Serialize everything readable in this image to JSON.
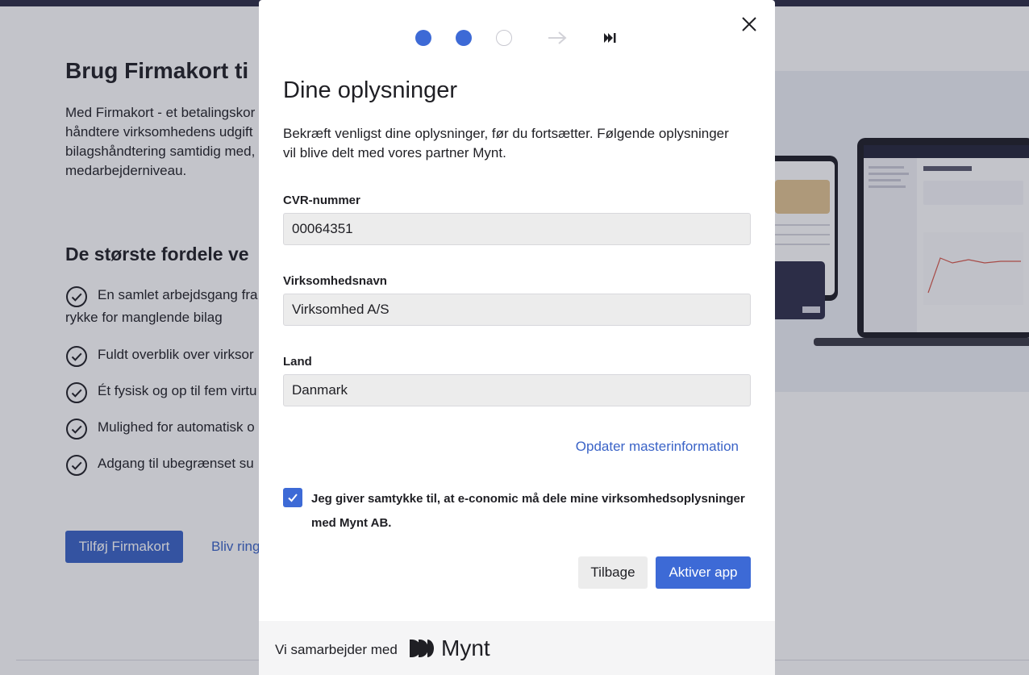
{
  "background": {
    "title": "Brug Firmakort ti",
    "intro_lines": [
      "Med Firmakort - et betalingskor",
      "håndtere virksomhedens udgift",
      "bilagshåndtering samtidig med,",
      "medarbejderniveau."
    ],
    "subtitle": "De største fordele ve",
    "benefits": [
      "En samlet arbejdsgang fra",
      "rykke for manglende bilag",
      "Fuldt overblik over virksor",
      "Ét fysisk og op til fem virtu",
      "Mulighed for automatisk o",
      "Adgang til ubegrænset su"
    ],
    "primary_button": "Tilføj Firmakort",
    "secondary_link": "Bliv ring"
  },
  "modal": {
    "steps": [
      {
        "state": "done"
      },
      {
        "state": "done"
      },
      {
        "state": "todo"
      }
    ],
    "title": "Dine oplysninger",
    "description_lines": [
      "Bekræft venligst dine oplysninger, før du fortsætter. Følgende oplysninger",
      "vil blive delt med vores partner Mynt."
    ],
    "fields": {
      "cvr_label": "CVR-nummer",
      "cvr_value": "00064351",
      "company_label": "Virksomhedsnavn",
      "company_value": "Virksomhed A/S",
      "country_label": "Land",
      "country_value": "Danmark"
    },
    "update_link": "Opdater masterinformation",
    "consent": {
      "checked": true,
      "lines": [
        "Jeg giver samtykke til, at e-conomic må dele mine virksomhedsoplysninger",
        "med Mynt AB."
      ]
    },
    "back_button": "Tilbage",
    "activate_button": "Aktiver app",
    "footer": {
      "partner_text": "Vi samarbejder med",
      "partner_name": "Mynt"
    }
  },
  "colors": {
    "accent": "#3d6ad6",
    "link": "#3a63c7",
    "field_bg": "#ececec",
    "topbar": "#2b2c44"
  },
  "icons": {
    "close": "close-icon",
    "checkmark": "checkmark-icon",
    "step_arrow": "arrow-right-icon",
    "step_end": "fast-forward-icon",
    "partner_logo": "mynt-logo-icon"
  }
}
